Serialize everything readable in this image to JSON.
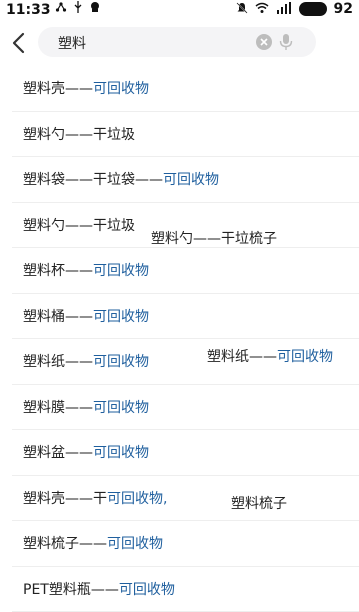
{
  "status_bar": {
    "time": "11:33",
    "battery_level": "92"
  },
  "search": {
    "query": "塑料"
  },
  "results": [
    {
      "name": "塑料壳——",
      "category": "可回收物"
    },
    {
      "name": "塑料勺——干垃圾",
      "category": ""
    },
    {
      "name": "塑料袋——干垃袋——",
      "category": "可回收物"
    },
    {
      "name": "塑料勺——干垃圾",
      "category": ""
    },
    {
      "name": "塑料杯——",
      "category": "可回收物"
    },
    {
      "name": "塑料桶——",
      "category": "可回收物"
    },
    {
      "name": "塑料纸——",
      "category": "可回收物"
    },
    {
      "name": "塑料膜——",
      "category": "可回收物"
    },
    {
      "name": "塑料盆——",
      "category": "可回收物"
    },
    {
      "name": "塑料壳——干",
      "category": "可回收物,"
    },
    {
      "name": "塑料梳子——",
      "category": "可回收物"
    },
    {
      "name": "PET塑料瓶——",
      "category": "可回收物"
    }
  ],
  "overlays": [
    {
      "name": "塑料勺——干垃梳子",
      "category": ""
    },
    {
      "name": "塑料纸——",
      "category": "可回收物"
    },
    {
      "name": "塑料梳子",
      "category": ""
    }
  ],
  "colors": {
    "category": "#1f5f9e",
    "text": "#222222",
    "search_bg": "#f4f4f6"
  }
}
